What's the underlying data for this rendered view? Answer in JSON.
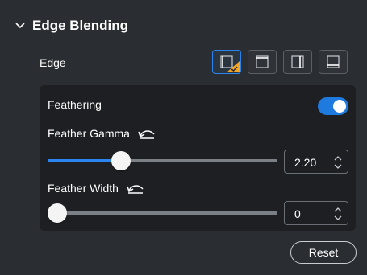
{
  "section": {
    "title": "Edge Blending"
  },
  "edge": {
    "label": "Edge",
    "options": [
      {
        "icon": "left-edge-icon",
        "selected": true
      },
      {
        "icon": "top-edge-icon",
        "selected": false
      },
      {
        "icon": "right-edge-icon",
        "selected": false
      },
      {
        "icon": "bottom-edge-icon",
        "selected": false
      }
    ]
  },
  "feathering": {
    "label": "Feathering",
    "enabled": true
  },
  "feather_gamma": {
    "label": "Feather Gamma",
    "value": "2.20",
    "slider_fraction": 0.32
  },
  "feather_width": {
    "label": "Feather Width",
    "value": "0",
    "slider_fraction": 0.0
  },
  "reset": {
    "label": "Reset"
  },
  "colors": {
    "accent": "#2b85f0",
    "check_badge": "#f5a623",
    "panel_bg": "#2a2d31",
    "inner_bg": "#1d1f22"
  }
}
